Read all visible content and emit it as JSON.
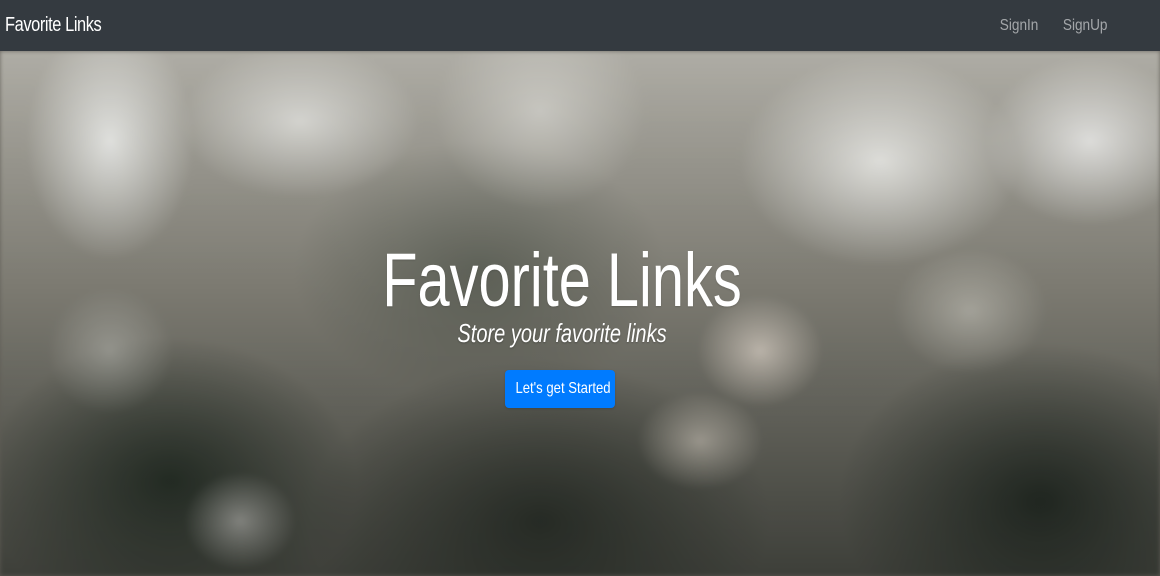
{
  "nav": {
    "brand": "Favorite Links",
    "links": [
      "SignIn",
      "SignUp"
    ]
  },
  "hero": {
    "title": "Favorite Links",
    "subtitle": "Store your favorite links",
    "cta": "Let's get Started"
  },
  "colors": {
    "navbar": "#343a40",
    "nav_link": "#9aa0a6",
    "primary_button": "#007bff",
    "text": "#ffffff"
  },
  "icons": []
}
